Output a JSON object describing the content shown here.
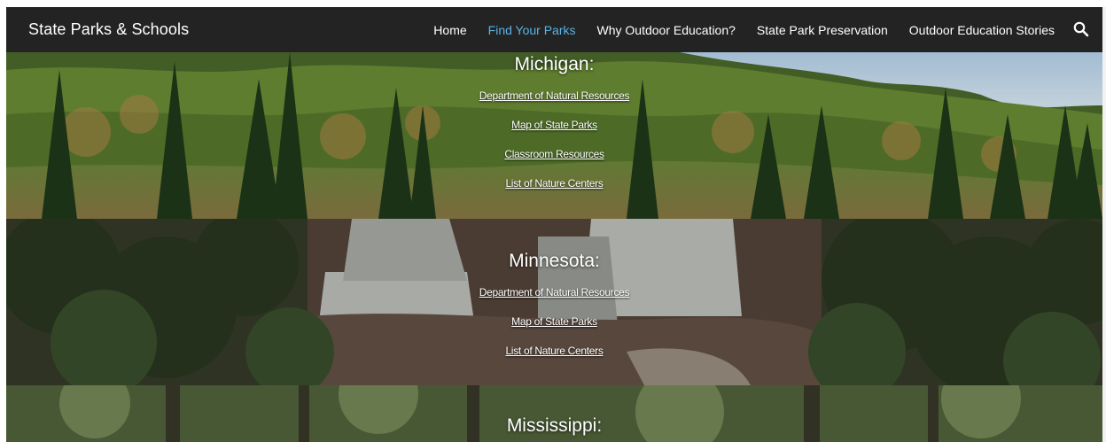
{
  "site": {
    "title": "State Parks & Schools"
  },
  "nav": {
    "items": [
      {
        "label": "Home",
        "active": false
      },
      {
        "label": "Find Your Parks",
        "active": true
      },
      {
        "label": "Why Outdoor Education?",
        "active": false
      },
      {
        "label": "State Park Preservation",
        "active": false
      },
      {
        "label": "Outdoor Education Stories",
        "active": false
      }
    ],
    "search_icon": "search-icon"
  },
  "colors": {
    "nav_bg": "#232323",
    "nav_active": "#58b4e7",
    "text": "#ffffff"
  },
  "sections": {
    "michigan": {
      "title": "Michigan:",
      "links": [
        "Department of Natural Resources",
        "Map of State Parks",
        "Classroom Resources",
        "List of Nature Centers"
      ]
    },
    "minnesota": {
      "title": "Minnesota:",
      "links": [
        "Department of Natural Resources",
        "Map of State Parks",
        "List of Nature Centers"
      ]
    },
    "mississippi": {
      "title": "Mississippi:"
    }
  }
}
